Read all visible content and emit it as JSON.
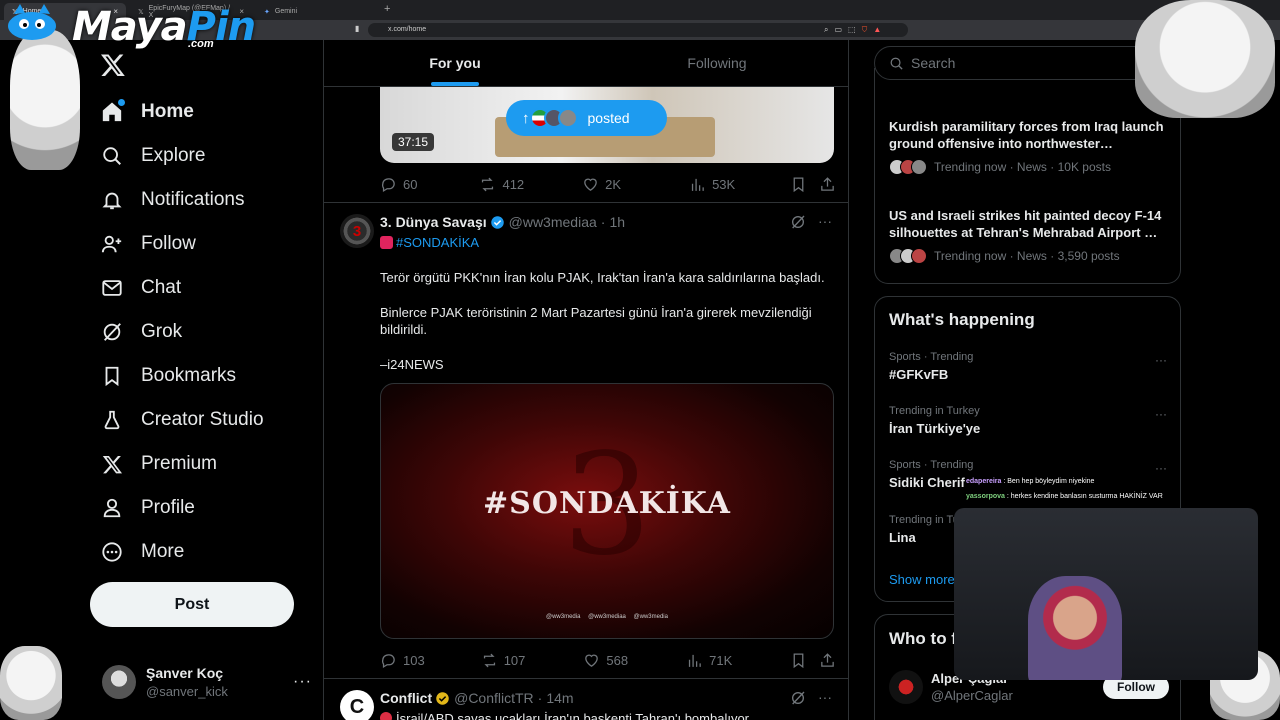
{
  "browser": {
    "tabs": [
      {
        "label": "Home",
        "active": true
      },
      {
        "label": "EpicFuryMap (@EFMap) / X",
        "active": false
      },
      {
        "label": "Gemini",
        "active": false
      }
    ],
    "url": "x.com/home"
  },
  "branding": {
    "name_main": "Maya",
    "name_accent": "Pin",
    "suffix": ".com"
  },
  "nav": {
    "items": [
      {
        "label": "Home",
        "icon": "home-icon"
      },
      {
        "label": "Explore",
        "icon": "search-icon"
      },
      {
        "label": "Notifications",
        "icon": "bell-icon"
      },
      {
        "label": "Follow",
        "icon": "add-person-icon"
      },
      {
        "label": "Chat",
        "icon": "mail-icon"
      },
      {
        "label": "Grok",
        "icon": "grok-icon"
      },
      {
        "label": "Bookmarks",
        "icon": "bookmark-icon"
      },
      {
        "label": "Creator Studio",
        "icon": "flask-icon"
      },
      {
        "label": "Premium",
        "icon": "x-logo-icon"
      },
      {
        "label": "Profile",
        "icon": "person-icon"
      },
      {
        "label": "More",
        "icon": "more-circle-icon"
      }
    ],
    "post_label": "Post",
    "account": {
      "name": "Şanver Koç",
      "handle": "@sanver_kick"
    }
  },
  "timeline": {
    "tabs": [
      "For you",
      "Following"
    ],
    "posted_pill": "posted",
    "prev_post": {
      "duration": "37:15",
      "stats": {
        "replies": "60",
        "reposts": "412",
        "likes": "2K",
        "views": "53K"
      }
    },
    "post1": {
      "name": "3. Dünya Savaşı",
      "handle": "@ww3mediaa",
      "time": "1h",
      "avatar_text": "3",
      "hashtag": "#SONDAKİKA",
      "para1": "Terör örgütü PKK'nın İran kolu PJAK, Irak'tan İran'a kara saldırılarına başladı.",
      "para2": "Binlerce PJAK teröristinin 2 Mart Pazartesi günü İran'a girerek mevzilendiği bildirildi.",
      "para3": "–i24NEWS",
      "image_title": "#SONDAKİKA",
      "image_footer": "@ww3media @ww3mediaa @ww3media",
      "stats": {
        "replies": "103",
        "reposts": "107",
        "likes": "568",
        "views": "71K"
      }
    },
    "post2": {
      "name": "Conflict",
      "handle": "@ConflictTR",
      "time": "14m",
      "text": "İsrail/ABD savaş uçakları İran'ın başkenti Tahran'ı bombalıyor."
    }
  },
  "right": {
    "search_placeholder": "Search",
    "news": [
      {
        "title": "Kurdish paramilitary forces from Iraq launch ground offensive into northwester…",
        "meta": "Trending now · News · 10K posts"
      },
      {
        "title": "US and Israeli strikes hit painted decoy F-14 silhouettes at Tehran's Mehrabad Airport …",
        "meta": "Trending now · News · 3,590 posts"
      }
    ],
    "whats_happening": {
      "title": "What's happening",
      "trends": [
        {
          "category": "Sports · Trending",
          "name": "#GFKvFB"
        },
        {
          "category": "Trending in Turkey",
          "name": "İran Türkiye'ye"
        },
        {
          "category": "Sports · Trending",
          "name": "Sidiki Cherif"
        },
        {
          "category": "Trending in Turkey",
          "name": "Lina"
        }
      ],
      "show_more": "Show more"
    },
    "who_to_follow": {
      "title": "Who to follow",
      "name": "Alper Çağlar",
      "handle": "@AlperCaglar",
      "button": "Follow"
    }
  },
  "stream_chat": [
    {
      "user": "edapereira",
      "message": ": Ben hep böyleydim niyekine"
    },
    {
      "user": "yassorpova",
      "message": ": herkes kendine banlasın susturma HAKİNİZ VAR"
    }
  ],
  "colors": {
    "accent": "#1d9bf0",
    "text": "#e7e9ea",
    "muted": "#71767b",
    "border": "#2f3336"
  }
}
